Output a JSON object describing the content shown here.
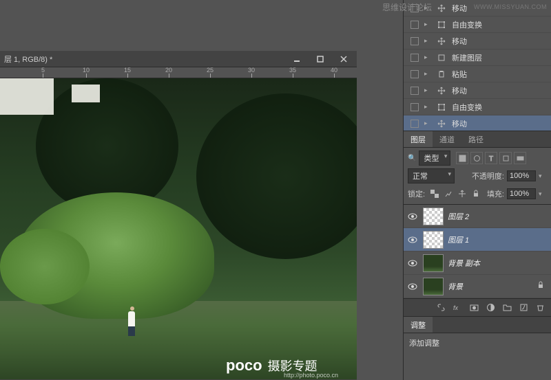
{
  "watermarks": {
    "top_text": "思维设计论坛",
    "top_url": "WWW.MISSYUAN.COM",
    "poco_logo": "poco",
    "poco_text": "摄影专题",
    "poco_url": "http://photo.poco.cn"
  },
  "document": {
    "title_fragment": "层 1, RGB/8) *",
    "ruler_ticks": [
      "5",
      "10",
      "15",
      "20",
      "25",
      "30",
      "35",
      "40"
    ]
  },
  "history": {
    "items": [
      {
        "label": "移动",
        "icon": "move"
      },
      {
        "label": "自由变换",
        "icon": "transform"
      },
      {
        "label": "移动",
        "icon": "move"
      },
      {
        "label": "新建图层",
        "icon": "new-layer"
      },
      {
        "label": "粘贴",
        "icon": "paste"
      },
      {
        "label": "移动",
        "icon": "move"
      },
      {
        "label": "自由变换",
        "icon": "transform"
      },
      {
        "label": "移动",
        "icon": "move",
        "selected": true
      }
    ]
  },
  "layers_panel": {
    "tabs": [
      "图层",
      "通道",
      "路径"
    ],
    "filter_label": "类型",
    "blend_mode": "正常",
    "opacity_label": "不透明度:",
    "opacity_value": "100%",
    "lock_label": "锁定:",
    "fill_label": "填充:",
    "fill_value": "100%",
    "layers": [
      {
        "name": "图层 2",
        "thumb": "checker",
        "visible": true
      },
      {
        "name": "图层 1",
        "thumb": "checker",
        "visible": true,
        "selected": true
      },
      {
        "name": "背景 副本",
        "thumb": "img",
        "visible": true
      },
      {
        "name": "背景",
        "thumb": "img",
        "visible": true,
        "locked": true
      }
    ]
  },
  "adjustments": {
    "tab": "调整",
    "add_label": "添加调整"
  }
}
